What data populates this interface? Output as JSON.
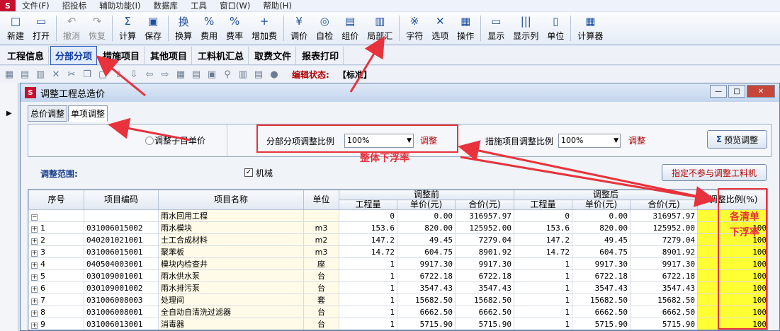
{
  "menu": {
    "items": [
      "文件(F)",
      "招投标",
      "辅助功能(I)",
      "数据库",
      "工具",
      "窗口(W)",
      "帮助(H)"
    ]
  },
  "toolbar": {
    "buttons": [
      {
        "label": "新建",
        "icon": "new-file-icon",
        "glyph": "□"
      },
      {
        "label": "打开",
        "icon": "open-folder-icon",
        "glyph": "▭"
      },
      {
        "label": "撤消",
        "icon": "undo-icon",
        "glyph": "↶",
        "disabled": true
      },
      {
        "label": "恢复",
        "icon": "redo-icon",
        "glyph": "↷",
        "disabled": true
      },
      {
        "label": "计算",
        "icon": "sigma-icon",
        "glyph": "Σ"
      },
      {
        "label": "保存",
        "icon": "save-icon",
        "glyph": "▣"
      },
      {
        "label": "换算",
        "icon": "convert-icon",
        "glyph": "换"
      },
      {
        "label": "费用",
        "icon": "fee-icon",
        "glyph": "%"
      },
      {
        "label": "费率",
        "icon": "rate-icon",
        "glyph": "%"
      },
      {
        "label": "增加费",
        "icon": "add-fee-icon",
        "glyph": "+"
      },
      {
        "label": "调价",
        "icon": "yen-icon",
        "glyph": "¥"
      },
      {
        "label": "自检",
        "icon": "self-check-icon",
        "glyph": "◎"
      },
      {
        "label": "组价",
        "icon": "group-price-icon",
        "glyph": "▤"
      },
      {
        "label": "局部汇",
        "icon": "partial-summary-icon",
        "glyph": "▥"
      },
      {
        "label": "字符",
        "icon": "char-icon",
        "glyph": "※"
      },
      {
        "label": "选项",
        "icon": "options-icon",
        "glyph": "✕"
      },
      {
        "label": "操作",
        "icon": "operate-icon",
        "glyph": "▦"
      },
      {
        "label": "显示",
        "icon": "display-icon",
        "glyph": "▭"
      },
      {
        "label": "显示列",
        "icon": "columns-icon",
        "glyph": "|||"
      },
      {
        "label": "单位",
        "icon": "unit-icon",
        "glyph": "▯"
      },
      {
        "label": "计算器",
        "icon": "calculator-icon",
        "glyph": "▦"
      }
    ]
  },
  "tabs": [
    "工程信息",
    "分部分项",
    "措施项目",
    "其他项目",
    "工料机汇总",
    "取费文件",
    "报表打印"
  ],
  "edit_status": {
    "label": "编辑状态:",
    "value": "【标准】"
  },
  "dialog": {
    "title": "调整工程总造价",
    "tabs": [
      "总价调整",
      "单项调整"
    ],
    "radio_label": "调整子目单价",
    "fen_bu_label": "分部分项调整比例",
    "fen_bu_value": "100%",
    "fen_bu_adjust": "调整",
    "cuo_shi_label": "措施项目调整比例",
    "cuo_shi_value": "100%",
    "cuo_shi_adjust": "调整",
    "preview_label": "预览调整",
    "range_label": "调整范围:",
    "machine_label": "机械",
    "exclude_label": "指定不参与调整工料机"
  },
  "grid": {
    "headers": {
      "seq": "序号",
      "code": "项目编码",
      "name": "项目名称",
      "unit": "单位",
      "before": "调整前",
      "after": "调整后",
      "qty": "工程量",
      "price": "单价(元)",
      "total": "合价(元)",
      "ratio": "调整比例(%)"
    },
    "rows": [
      {
        "seq": "",
        "code": "",
        "name": "雨水回用工程",
        "unit": "",
        "qty_b": "0",
        "price_b": "0.00",
        "total_b": "316957.97",
        "qty_a": "0",
        "price_a": "0.00",
        "total_a": "316957.97",
        "ratio": ""
      },
      {
        "seq": "1",
        "code": "031006015002",
        "name": "雨水模块",
        "unit": "m3",
        "qty_b": "153.6",
        "price_b": "820.00",
        "total_b": "125952.00",
        "qty_a": "153.6",
        "price_a": "820.00",
        "total_a": "125952.00",
        "ratio": "100"
      },
      {
        "seq": "2",
        "code": "040201021001",
        "name": "土工合成材料",
        "unit": "m2",
        "qty_b": "147.2",
        "price_b": "49.45",
        "total_b": "7279.04",
        "qty_a": "147.2",
        "price_a": "49.45",
        "total_a": "7279.04",
        "ratio": "100"
      },
      {
        "seq": "3",
        "code": "031006015001",
        "name": "聚苯板",
        "unit": "m3",
        "qty_b": "14.72",
        "price_b": "604.75",
        "total_b": "8901.92",
        "qty_a": "14.72",
        "price_a": "604.75",
        "total_a": "8901.92",
        "ratio": "100"
      },
      {
        "seq": "4",
        "code": "040504003001",
        "name": "模块内检查井",
        "unit": "座",
        "qty_b": "1",
        "price_b": "9917.30",
        "total_b": "9917.30",
        "qty_a": "1",
        "price_a": "9917.30",
        "total_a": "9917.30",
        "ratio": "100"
      },
      {
        "seq": "5",
        "code": "030109001001",
        "name": "雨水供水泵",
        "unit": "台",
        "qty_b": "1",
        "price_b": "6722.18",
        "total_b": "6722.18",
        "qty_a": "1",
        "price_a": "6722.18",
        "total_a": "6722.18",
        "ratio": "100"
      },
      {
        "seq": "6",
        "code": "030109001002",
        "name": "雨水排污泵",
        "unit": "台",
        "qty_b": "1",
        "price_b": "3547.43",
        "total_b": "3547.43",
        "qty_a": "1",
        "price_a": "3547.43",
        "total_a": "3547.43",
        "ratio": "100"
      },
      {
        "seq": "7",
        "code": "031006008003",
        "name": "处理间",
        "unit": "套",
        "qty_b": "1",
        "price_b": "15682.50",
        "total_b": "15682.50",
        "qty_a": "1",
        "price_a": "15682.50",
        "total_a": "15682.50",
        "ratio": "100"
      },
      {
        "seq": "8",
        "code": "031006008001",
        "name": "全自动自清洗过滤器",
        "unit": "台",
        "qty_b": "1",
        "price_b": "6662.50",
        "total_b": "6662.50",
        "qty_a": "1",
        "price_a": "6662.50",
        "total_a": "6662.50",
        "ratio": "100"
      },
      {
        "seq": "9",
        "code": "031006013001",
        "name": "消毒器",
        "unit": "台",
        "qty_b": "1",
        "price_b": "5715.90",
        "total_b": "5715.90",
        "qty_a": "1",
        "price_a": "5715.90",
        "total_a": "5715.90",
        "ratio": "100"
      }
    ]
  },
  "annotations": {
    "overall": "整体下浮率",
    "each_line1": "各清单",
    "each_line2": "下浮率"
  },
  "colors": {
    "accent": "#1e4f9e",
    "annotation": "#e8323c",
    "ratio_bg": "#ffff33",
    "brand": "#c8102e"
  }
}
